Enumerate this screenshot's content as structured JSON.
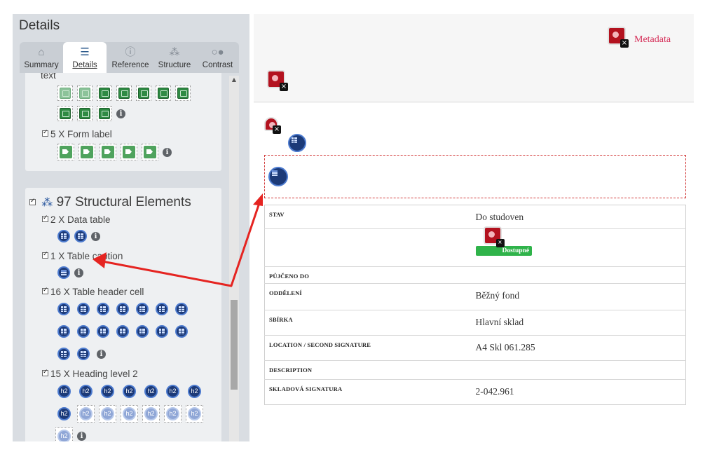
{
  "sidebar": {
    "title": "Details",
    "tabs": [
      {
        "label": "Summary",
        "icon": "home-icon"
      },
      {
        "label": "Details",
        "icon": "list-icon"
      },
      {
        "label": "Reference",
        "icon": "info-icon"
      },
      {
        "label": "Structure",
        "icon": "structure-icon"
      },
      {
        "label": "Contrast",
        "icon": "contrast-icon"
      }
    ],
    "partial_label": "text",
    "form_label_row": "5 X Form label",
    "structural_heading": "97 Structural Elements",
    "items": [
      {
        "label": "2 X Data table"
      },
      {
        "label": "1 X Table caption"
      },
      {
        "label": "16 X Table header cell"
      },
      {
        "label": "15 X Heading level 2"
      }
    ],
    "h2_text": "h2"
  },
  "main": {
    "metadata_link": "Metadata",
    "rows": [
      {
        "header": "STAV",
        "value": "Do studoven"
      },
      {
        "header": "",
        "value": "",
        "badge": "Dostupné"
      },
      {
        "header": "PŮJČENO DO",
        "value": ""
      },
      {
        "header": "ODDĚLENÍ",
        "value": "Běžný fond"
      },
      {
        "header": "SBÍRKA",
        "value": "Hlavní sklad"
      },
      {
        "header": "LOCATION / SECOND SIGNATURE",
        "value": "A4 Skl 061.285"
      },
      {
        "header": "DESCRIPTION",
        "value": ""
      },
      {
        "header": "SKLADOVÁ SIGNATURA",
        "value": "2-042.961"
      }
    ]
  },
  "colors": {
    "accent_link": "#d6305a",
    "annotation_arrow": "#e52421",
    "available_badge": "#2fb34a"
  }
}
